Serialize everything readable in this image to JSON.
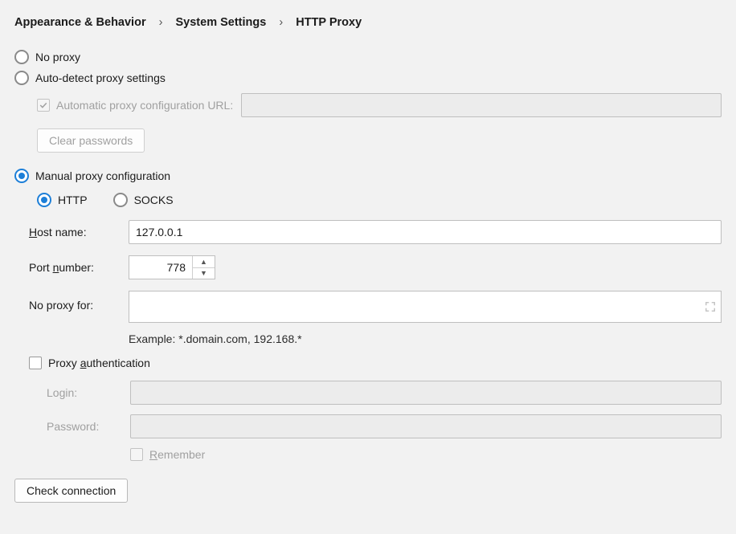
{
  "breadcrumb": {
    "item1": "Appearance & Behavior",
    "item2": "System Settings",
    "item3": "HTTP Proxy"
  },
  "options": {
    "no_proxy": "No proxy",
    "auto_detect": "Auto-detect proxy settings",
    "auto_url_label": "Automatic proxy configuration URL:",
    "auto_url_value": "",
    "clear_passwords": "Clear passwords",
    "manual": "Manual proxy configuration",
    "http": "HTTP",
    "socks": "SOCKS",
    "selected_top": "manual",
    "selected_protocol": "http"
  },
  "fields": {
    "host_label_prefix": "H",
    "host_label_rest": "ost name:",
    "host_value": "127.0.0.1",
    "port_label_prefix": "Port ",
    "port_label_mnemonic": "n",
    "port_label_rest": "umber:",
    "port_value": "778",
    "no_proxy_for_label": "No proxy for:",
    "no_proxy_for_value": "",
    "example": "Example: *.domain.com, 192.168.*"
  },
  "auth": {
    "checkbox_prefix": "Proxy ",
    "checkbox_mnemonic": "a",
    "checkbox_rest": "uthentication",
    "login_label": "Login:",
    "login_value": "",
    "password_label": "Password:",
    "password_value": "",
    "remember_mnemonic": "R",
    "remember_rest": "emember"
  },
  "check_connection": "Check connection"
}
